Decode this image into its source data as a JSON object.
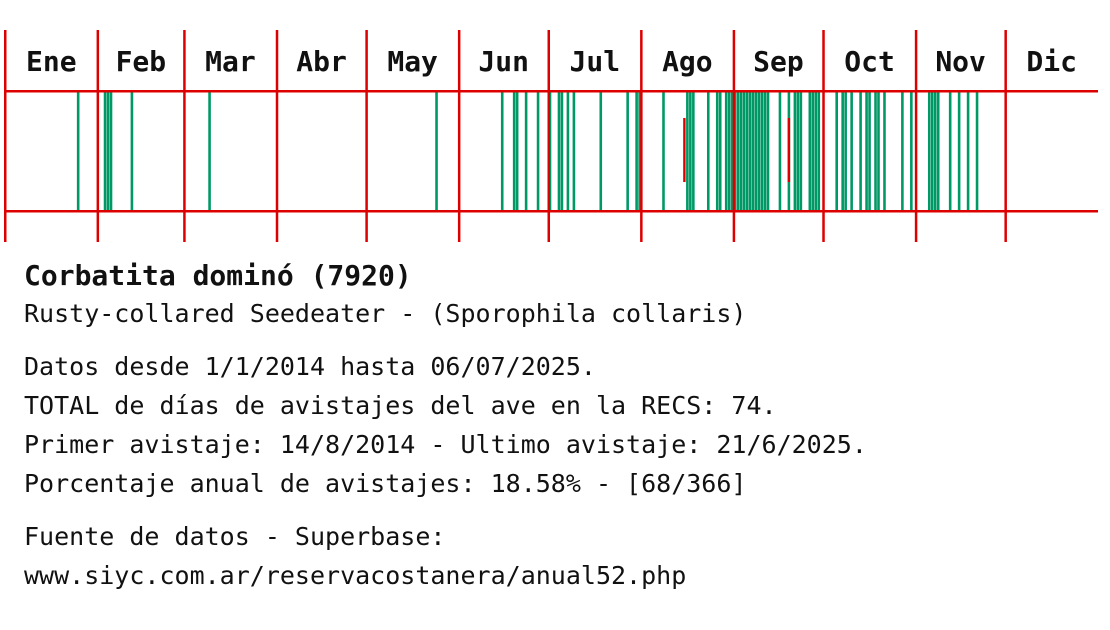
{
  "chart_data": {
    "type": "bar",
    "months": [
      "Ene",
      "Feb",
      "Mar",
      "Abr",
      "May",
      "Jun",
      "Jul",
      "Ago",
      "Sep",
      "Oct",
      "Nov",
      "Dic"
    ],
    "days_in_month": [
      31,
      29,
      31,
      30,
      31,
      30,
      31,
      31,
      30,
      31,
      30,
      31
    ],
    "xlim": [
      1,
      366
    ],
    "sighting_days": [
      25,
      34,
      35,
      36,
      43,
      69,
      145,
      167,
      171,
      172,
      175,
      179,
      183,
      186,
      187,
      189,
      191,
      200,
      209,
      212,
      213,
      221,
      229,
      230,
      231,
      236,
      239,
      240,
      242,
      243,
      244,
      245,
      246,
      247,
      248,
      249,
      250,
      251,
      252,
      253,
      254,
      255,
      256,
      260,
      263,
      265,
      266,
      267,
      270,
      271,
      272,
      273,
      279,
      281,
      282,
      284,
      287,
      289,
      290,
      292,
      293,
      295,
      301,
      304,
      310,
      311,
      312,
      313,
      317,
      320,
      323,
      326
    ],
    "last_sighting_markers": [
      228,
      263
    ],
    "colors": {
      "sighting": "#009966",
      "grid": "#dd0000",
      "marker": "#dd0000"
    }
  },
  "info": {
    "title": "Corbatita dominó (7920)",
    "subtitle": "Rusty-collared Seedeater - (Sporophila collaris)",
    "lines": [
      "Datos desde 1/1/2014 hasta 06/07/2025.",
      "TOTAL de días de avistajes del ave en la RECS: 74.",
      "Primer avistaje: 14/8/2014 - Ultimo avistaje: 21/6/2025.",
      "Porcentaje anual de avistajes: 18.58% - [68/366]"
    ],
    "source_label": "Fuente de datos - Superbase:",
    "source_url": "www.siyc.com.ar/reservacostanera/anual52.php"
  }
}
